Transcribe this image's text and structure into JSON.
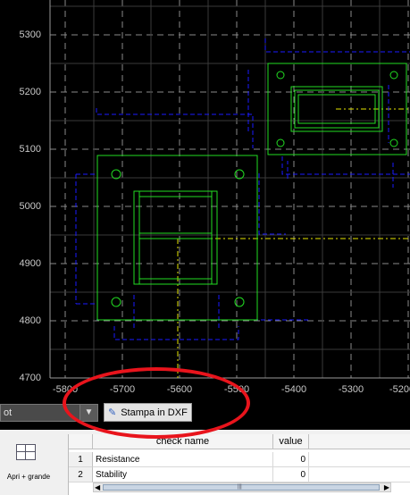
{
  "plot": {
    "y_ticks": [
      "5300",
      "5200",
      "5100",
      "5000",
      "4900",
      "4800",
      "4700"
    ],
    "x_ticks": [
      "-5800",
      "-5700",
      "-5600",
      "-5500",
      "-5400",
      "-5300",
      "-5200"
    ],
    "background": "#000000",
    "colors": {
      "outline": "#22dd22",
      "dimension": "#1a1aff",
      "axis": "#e6e600",
      "grid": "#8a8a8a"
    }
  },
  "controls": {
    "combo_value": "ot",
    "combo_arrow": "▼",
    "dxf_button_icon": "pencil-icon",
    "dxf_button_label": "Stampa in DXF"
  },
  "sidebar": {
    "grande_icon": "table-grid-icon",
    "grande_label": "Apri + grande"
  },
  "table": {
    "columns": [
      "check name",
      "value"
    ],
    "rows": [
      {
        "num": "1",
        "name": "Resistance",
        "value": "0"
      },
      {
        "num": "2",
        "name": "Stability",
        "value": "0"
      }
    ]
  },
  "highlight": {
    "color": "#e8141c"
  }
}
